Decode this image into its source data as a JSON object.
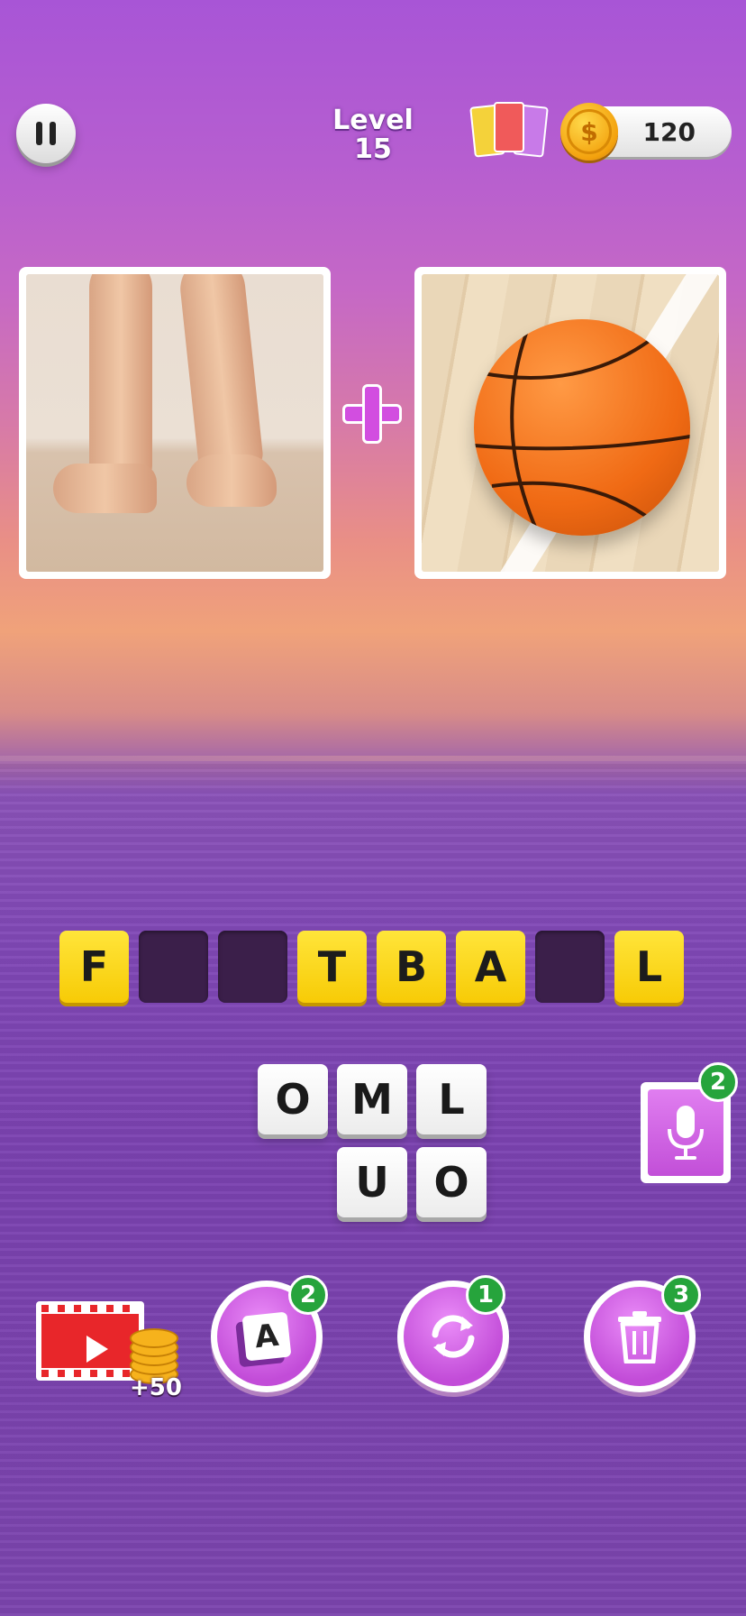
{
  "header": {
    "level_label": "Level",
    "level_number": "15",
    "coins": "120",
    "coin_symbol": "$"
  },
  "puzzle": {
    "image_left": "bare-feet-photo",
    "image_right": "basketball-photo",
    "operator": "+"
  },
  "answer_slots": [
    "F",
    "",
    "",
    "T",
    "B",
    "A",
    "",
    "L"
  ],
  "letter_tiles": [
    "O",
    "M",
    "L",
    "U",
    "O"
  ],
  "hints": {
    "mic_count": "2",
    "video_reward": "+50",
    "reveal_letter": {
      "label": "A",
      "count": "2"
    },
    "shuffle_count": "1",
    "delete_count": "3"
  },
  "colors": {
    "slot_filled": "#f7cb06",
    "slot_empty": "#3b1f4a",
    "badge": "#26a43c",
    "button_purple": "#c24cd8"
  }
}
